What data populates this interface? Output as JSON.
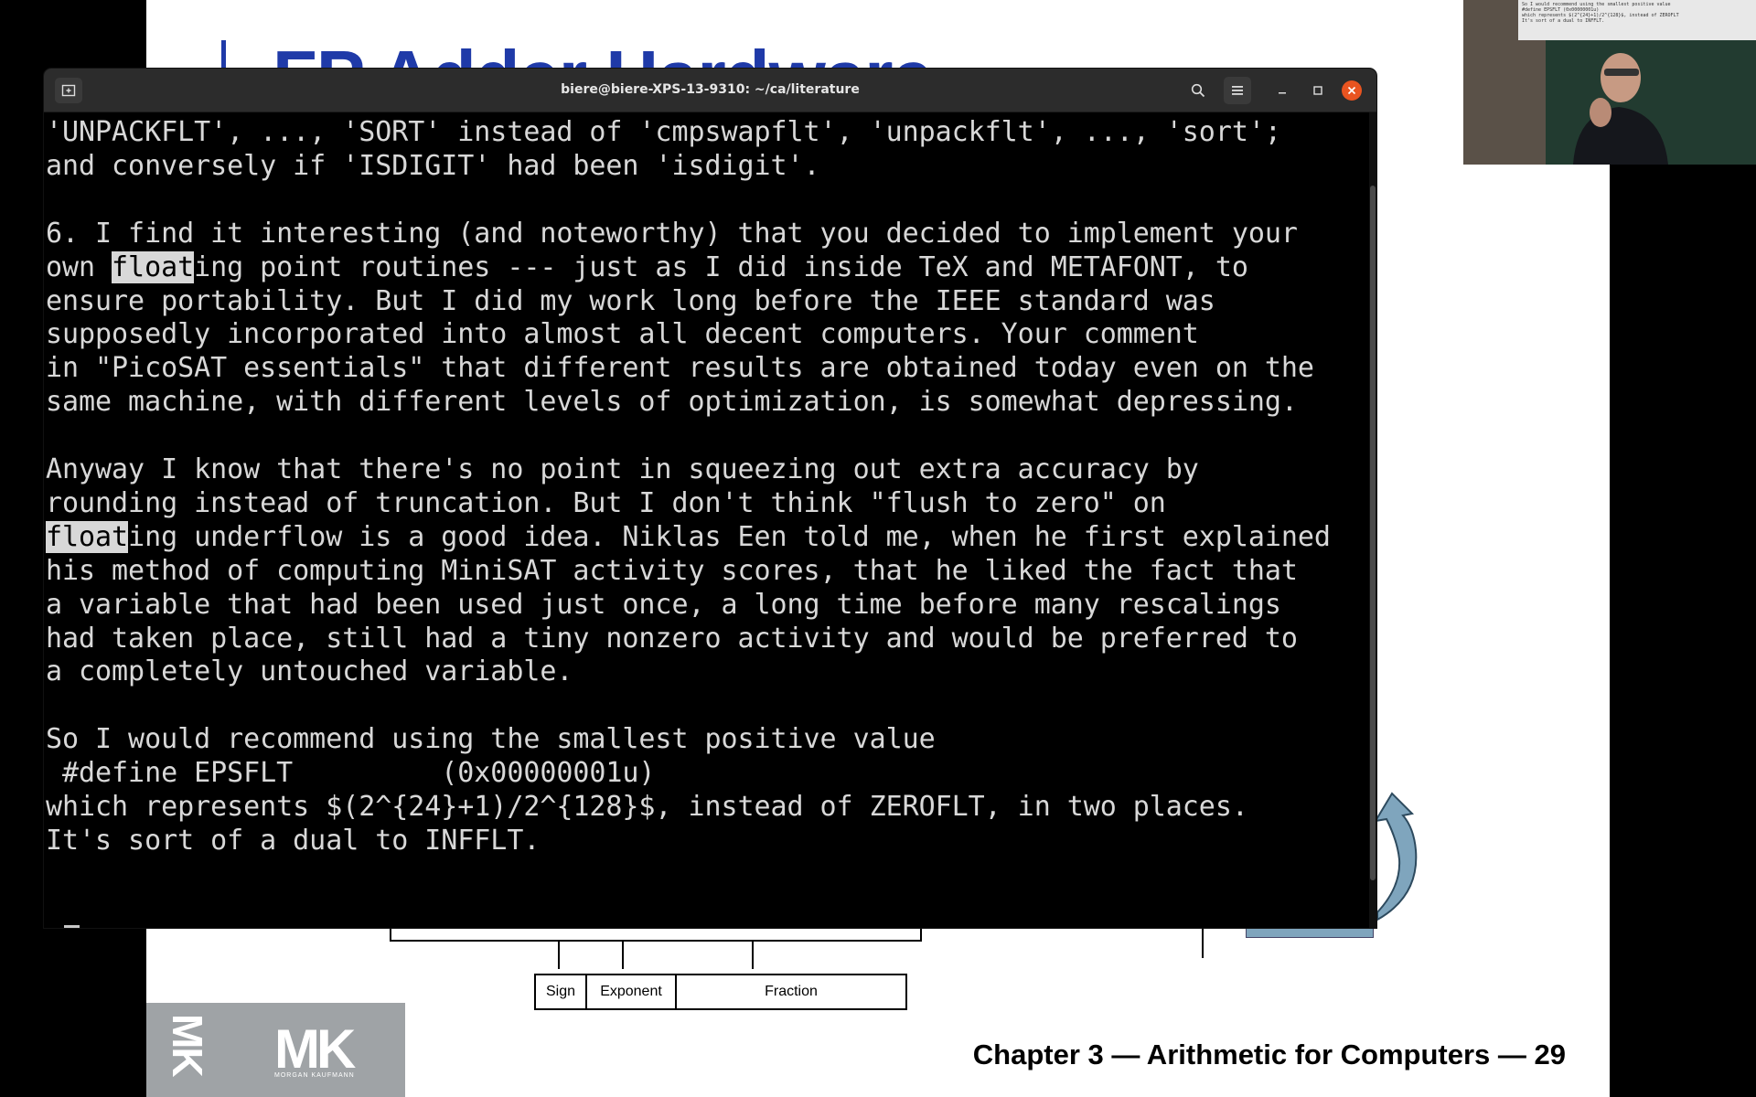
{
  "slide": {
    "title": "FP Adder Hardware",
    "footer_chapter": "Chapter 3 — Arithmetic for Computers — 29",
    "logo_letters": "MK",
    "logo_sub": "MORGAN KAUFMANN",
    "format_fields": [
      "Sign",
      "Exponent",
      "Fraction"
    ]
  },
  "webcam": {
    "screen_lines": [
      "So I would recommend using the smallest positive value",
      " #define EPSFLT        (0x00000001u)",
      "which represents $(2^{24}+1)/2^{128}$, instead of ZEROFLT",
      "It's sort of a dual to INFFLT."
    ]
  },
  "terminal": {
    "title": "biere@biere-XPS-13-9310: ~/ca/literature",
    "lines": [
      [
        {
          "t": "'UNPACKFLT', ..., 'SORT' instead of 'cmpswapflt', 'unpackflt', ..., 'sort';"
        }
      ],
      [
        {
          "t": "and conversely if 'ISDIGIT' had been 'isdigit'."
        }
      ],
      [
        {
          "t": ""
        }
      ],
      [
        {
          "t": "6. I find it interesting (and noteworthy) that you decided to implement your"
        }
      ],
      [
        {
          "t": "own "
        },
        {
          "t": "float",
          "hl": true
        },
        {
          "t": "ing point routines --- just as I did inside TeX and METAFONT, to"
        }
      ],
      [
        {
          "t": "ensure portability. But I did my work long before the IEEE standard was"
        }
      ],
      [
        {
          "t": "supposedly incorporated into almost all decent computers. Your comment"
        }
      ],
      [
        {
          "t": "in \"PicoSAT essentials\" that different results are obtained today even on the"
        }
      ],
      [
        {
          "t": "same machine, with different levels of optimization, is somewhat depressing."
        }
      ],
      [
        {
          "t": ""
        }
      ],
      [
        {
          "t": "Anyway I know that there's no point in squeezing out extra accuracy by"
        }
      ],
      [
        {
          "t": "rounding instead of truncation. But I don't think \"flush to zero\" on"
        }
      ],
      [
        {
          "t": "float",
          "hl": true
        },
        {
          "t": "ing underflow is a good idea. Niklas Een told me, when he first explained"
        }
      ],
      [
        {
          "t": "his method of computing MiniSAT activity scores, that he liked the fact that"
        }
      ],
      [
        {
          "t": "a variable that had been used just once, a long time before many rescalings"
        }
      ],
      [
        {
          "t": "had taken place, still had a tiny nonzero activity and would be preferred to"
        }
      ],
      [
        {
          "t": "a completely untouched variable."
        }
      ],
      [
        {
          "t": ""
        }
      ],
      [
        {
          "t": "So I would recommend using the smallest positive value"
        }
      ],
      [
        {
          "t": " #define EPSFLT         (0x00000001u)"
        }
      ],
      [
        {
          "t": "which represents $(2^{24}+1)/2^{128}$, instead of ZEROFLT, in two places."
        }
      ],
      [
        {
          "t": "It's sort of a dual to INFFLT."
        }
      ]
    ],
    "prompt": ":"
  },
  "icons": {
    "newtab": "new-tab-icon",
    "search": "search-icon",
    "menu": "hamburger-menu-icon",
    "minimize": "minimize-icon",
    "maximize": "maximize-icon",
    "close": "close-icon"
  },
  "colors": {
    "slide_title": "#1f3aa8",
    "terminal_bg": "#000000",
    "terminal_text": "#d8d8d8",
    "header_bg": "#2c2c2c",
    "close_button": "#e95420"
  }
}
